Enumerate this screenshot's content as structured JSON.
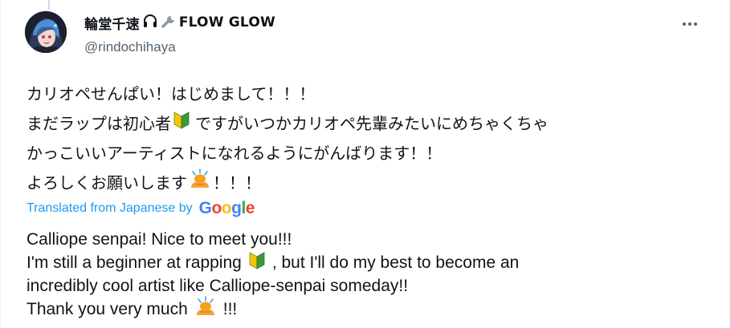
{
  "tweet": {
    "author": {
      "display_name": "輪堂千速",
      "display_name_suffix": "FLOW GLOW",
      "handle": "@rindochihaya"
    },
    "original_lines": [
      {
        "text_before": "カリオペせんぱい！はじめまして！！！",
        "emoji": "",
        "text_after": ""
      },
      {
        "text_before": "まだラップは初心者",
        "emoji": "beginner-mark-icon",
        "text_after": "ですがいつかカリオペ先輩みたいにめちゃくちゃ"
      },
      {
        "text_before": "かっこいいアーティストになれるようにがんばります！！",
        "emoji": "",
        "text_after": ""
      },
      {
        "text_before": "よろしくお願いします",
        "emoji": "bowing-person-icon",
        "text_after": "！！！"
      }
    ],
    "translation": {
      "label": "Translated from Japanese by",
      "provider": "Google",
      "lines": [
        {
          "text_before": "Calliope senpai! Nice to meet you!!!",
          "emoji": "",
          "text_after": ""
        },
        {
          "text_before": "I'm still a beginner at rapping",
          "emoji": "beginner-mark-icon",
          "text_after": ", but I'll do my best to become an"
        },
        {
          "text_before": "incredibly cool artist like Calliope-senpai someday!!",
          "emoji": "",
          "text_after": ""
        },
        {
          "text_before": "Thank you very much",
          "emoji": "bowing-person-icon",
          "text_after": "!!!"
        }
      ]
    },
    "colors": {
      "link": "#1d9bf0",
      "secondary_text": "#536471",
      "primary_text": "#0f1419"
    }
  }
}
